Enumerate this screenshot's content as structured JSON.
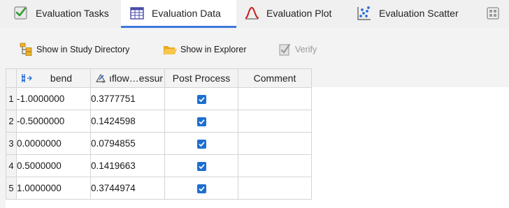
{
  "tabs": [
    {
      "label": "Evaluation Tasks",
      "icon": "checklist-icon",
      "active": false
    },
    {
      "label": "Evaluation Data",
      "icon": "table-icon",
      "active": true
    },
    {
      "label": "Evaluation Plot",
      "icon": "line-plot-icon",
      "active": false
    },
    {
      "label": "Evaluation Scatter",
      "icon": "scatter-plot-icon",
      "active": false
    }
  ],
  "tab_more_icon": "grid-layout-icon",
  "toolbar": {
    "study_label": "Show in Study Directory",
    "explorer_label": "Show in Explorer",
    "verify_label": "Verify"
  },
  "grid": {
    "columns": [
      "bend",
      "ıflow…essur",
      "Post Process",
      "Comment"
    ],
    "rows": [
      {
        "index": "1",
        "bend": "-1.0000000",
        "flow": "0.3777751",
        "post_process": true,
        "comment": ""
      },
      {
        "index": "2",
        "bend": "-0.5000000",
        "flow": "0.1424598",
        "post_process": true,
        "comment": ""
      },
      {
        "index": "3",
        "bend": "0.0000000",
        "flow": "0.0794855",
        "post_process": true,
        "comment": ""
      },
      {
        "index": "4",
        "bend": "0.5000000",
        "flow": "0.1419663",
        "post_process": true,
        "comment": ""
      },
      {
        "index": "5",
        "bend": "1.0000000",
        "flow": "0.3744974",
        "post_process": true,
        "comment": ""
      }
    ]
  },
  "colors": {
    "accent": "#3c78d8",
    "checkbox": "#1d6fd1",
    "disabled_text": "#9a9a9a"
  }
}
